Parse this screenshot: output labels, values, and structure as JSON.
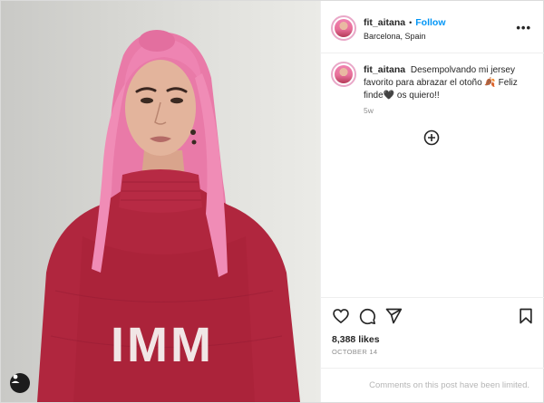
{
  "post": {
    "username": "fit_aitana",
    "separator": "•",
    "follow_label": "Follow",
    "location": "Barcelona, Spain",
    "more_label": "•••",
    "caption_text": "Desempolvando mi jersey favorito para abrazar el otoño 🍂 Feliz finde🖤 os quiero!!",
    "caption_time": "5w",
    "likes": "8,388 likes",
    "date": "OCTOBER 14",
    "comments_notice": "Comments on this post have been limited.",
    "sweater_text": "IMM"
  },
  "icons": {
    "like": "heart-icon",
    "comment": "comment-icon",
    "share": "send-icon",
    "save": "bookmark-icon",
    "more": "more-options-icon",
    "add": "plus-circle-icon",
    "tag": "user-tag-icon"
  },
  "colors": {
    "follow": "#0095f6",
    "muted": "#8e8e8e",
    "sweater": "#b0263e",
    "hair": "#ee7fae"
  }
}
